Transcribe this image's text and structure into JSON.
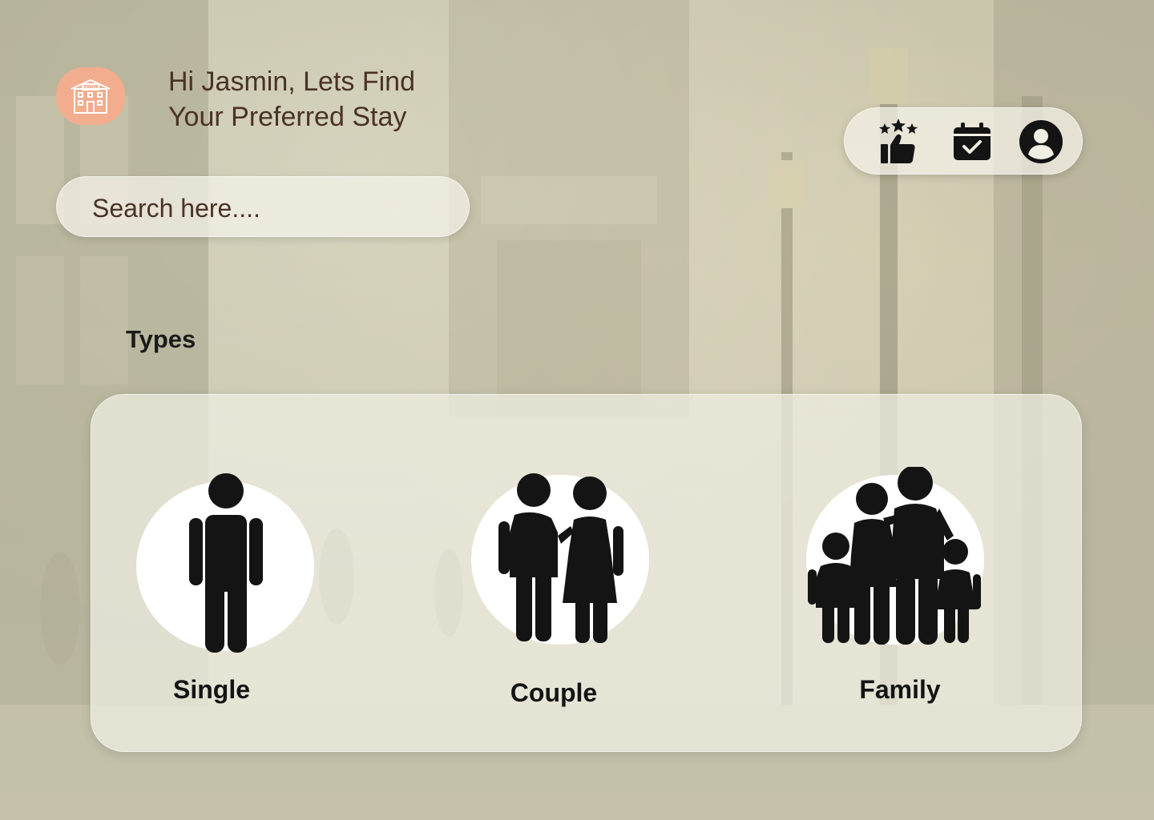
{
  "app": {
    "greeting_line1": "Hi Jasmin, Lets Find",
    "greeting_line2": "Your Preferred Stay",
    "logo_icon": "hotel-icon",
    "logo_text": "HOTEL"
  },
  "search": {
    "placeholder": "Search here....",
    "value": ""
  },
  "actions": [
    {
      "name": "recommended",
      "icon": "thumbs-up-stars-icon"
    },
    {
      "name": "bookings",
      "icon": "calendar-check-icon"
    },
    {
      "name": "profile",
      "icon": "account-circle-icon"
    }
  ],
  "types": {
    "heading": "Types",
    "items": [
      {
        "label": "Single",
        "icon": "single-person-icon"
      },
      {
        "label": "Couple",
        "icon": "couple-icon"
      },
      {
        "label": "Family",
        "icon": "family-icon"
      }
    ]
  },
  "colors": {
    "logo_bg": "#f2ad8f",
    "greeting_text": "#4a3225",
    "panel_bg": "#eeece0",
    "icon": "#141414"
  }
}
